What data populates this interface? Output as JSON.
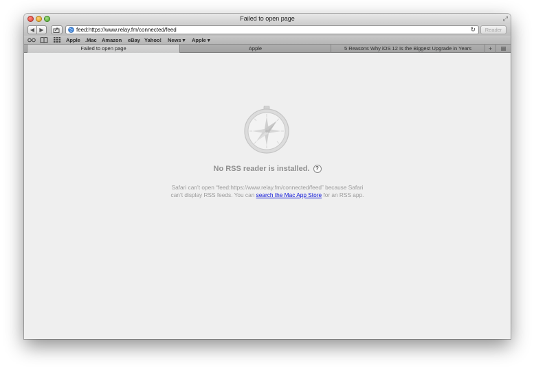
{
  "window": {
    "title": "Failed to open page"
  },
  "toolbar": {
    "back_glyph": "◀",
    "forward_glyph": "▶",
    "address": "feed:https://www.relay.fm/connected/feed",
    "reader_label": "Reader"
  },
  "bookmarks": [
    {
      "label": "Apple"
    },
    {
      "label": ".Mac"
    },
    {
      "label": "Amazon"
    },
    {
      "label": "eBay"
    },
    {
      "label": "Yahoo!"
    },
    {
      "label": "News ▾"
    },
    {
      "label": "Apple ▾"
    }
  ],
  "tabs": [
    {
      "label": "Failed to open page",
      "active": true
    },
    {
      "label": "Apple",
      "active": false
    },
    {
      "label": "5 Reasons Why iOS 12 Is the Biggest Upgrade in Years",
      "active": false
    }
  ],
  "tab_bar": {
    "new_tab_glyph": "+",
    "overview_glyph": "▤"
  },
  "content": {
    "heading": "No RSS reader is installed.",
    "help_glyph": "?",
    "message_line1": "Safari can’t open “feed:https://www.relay.fm/connected/feed” because Safari",
    "message_line2_pre": "can’t display RSS feeds. You can ",
    "link_text": "search the Mac App Store",
    "message_line2_post": " for an RSS app."
  },
  "icons": {
    "globe": "globe-icon",
    "compass": "compass-icon",
    "reload": "reload-icon",
    "reading_list": "glasses-icon",
    "bookmarks": "book-icon",
    "top_sites": "grid-icon"
  },
  "colors": {
    "link": "#0b12d8",
    "heading": "#8f8f8f",
    "content_bg": "#efefef"
  }
}
